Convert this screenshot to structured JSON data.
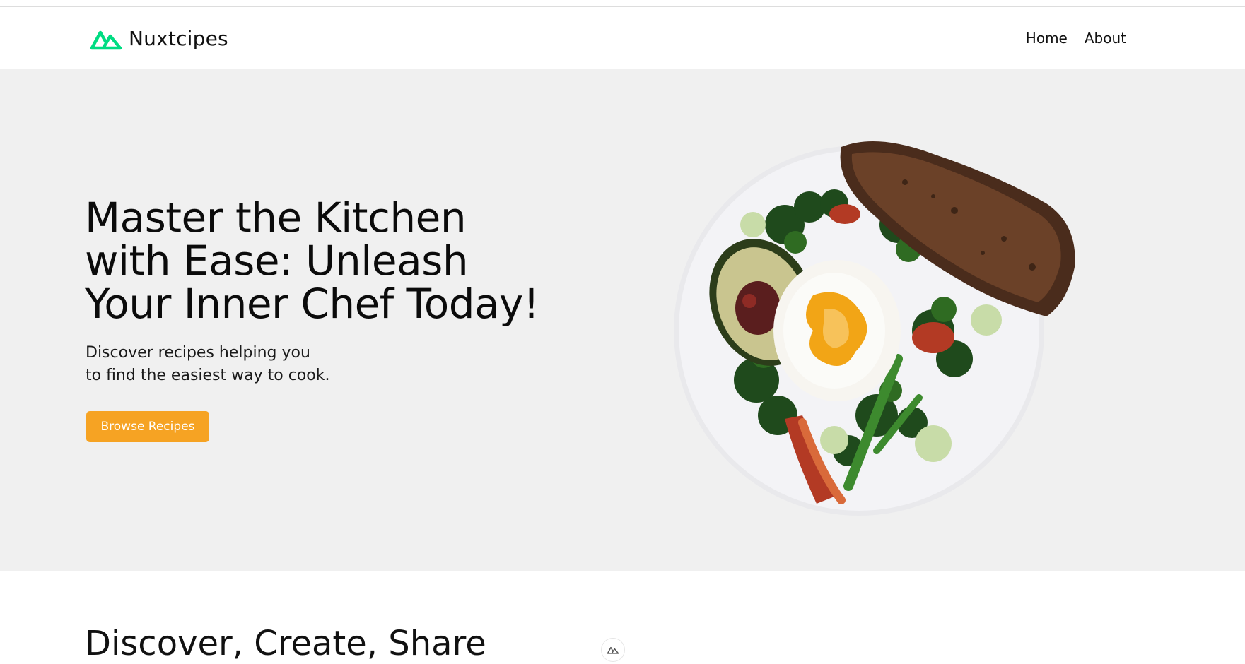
{
  "header": {
    "brand_name": "Nuxtcipes",
    "brand_logo_icon": "nuxt-logo-icon",
    "nav": [
      {
        "label": "Home"
      },
      {
        "label": "About"
      }
    ]
  },
  "hero": {
    "title_lines": [
      "Master the Kitchen",
      "with Ease: Unleash",
      "Your Inner Chef Today!"
    ],
    "subtitle_lines": [
      "Discover recipes helping you",
      "to find the easiest way to cook."
    ],
    "cta_label": "Browse Recipes",
    "image_icon": "plate-with-poached-egg-avocado-greens-and-bread"
  },
  "section": {
    "heading": "Discover, Create, Share"
  },
  "badge": {
    "icon": "nuxt-devtools-icon"
  },
  "colors": {
    "accent": "#00dc82",
    "cta": "#f6a323",
    "hero_bg": "#f0f0f0"
  }
}
